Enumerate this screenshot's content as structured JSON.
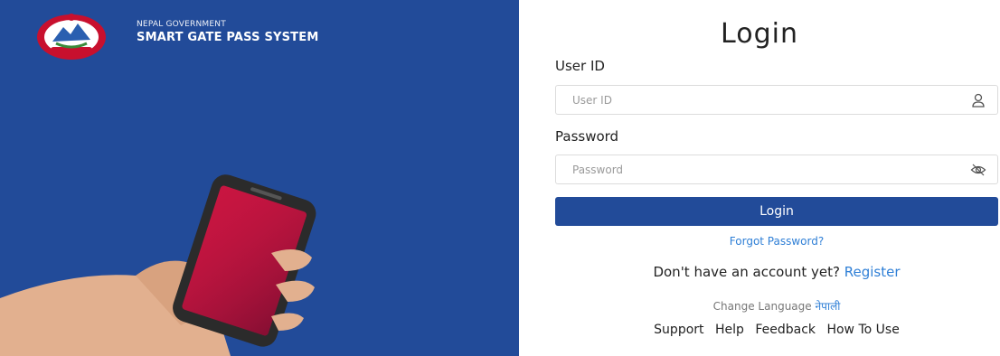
{
  "brand": {
    "subtitle": "NEPAL GOVERNMENT",
    "title": "SMART GATE PASS SYSTEM"
  },
  "login": {
    "title": "Login",
    "user_id_label": "User ID",
    "user_id_placeholder": "User ID",
    "password_label": "Password",
    "password_placeholder": "Password",
    "submit_label": "Login",
    "forgot_password": "Forgot Password?",
    "no_account_text": "Don't have an account yet?",
    "register_link": "Register",
    "change_language_label": "Change Language",
    "language_link": "नेपाली"
  },
  "footer": {
    "links": [
      "Support",
      "Help",
      "Feedback",
      "How To Use"
    ]
  },
  "icons": {
    "user_field": "user-icon",
    "password_field": "eye-slash-icon",
    "emblem": "nepal-emblem-icon"
  },
  "colors": {
    "primary": "#224b99",
    "link": "#2f7fd6",
    "phone_screen": "#c7143f"
  }
}
